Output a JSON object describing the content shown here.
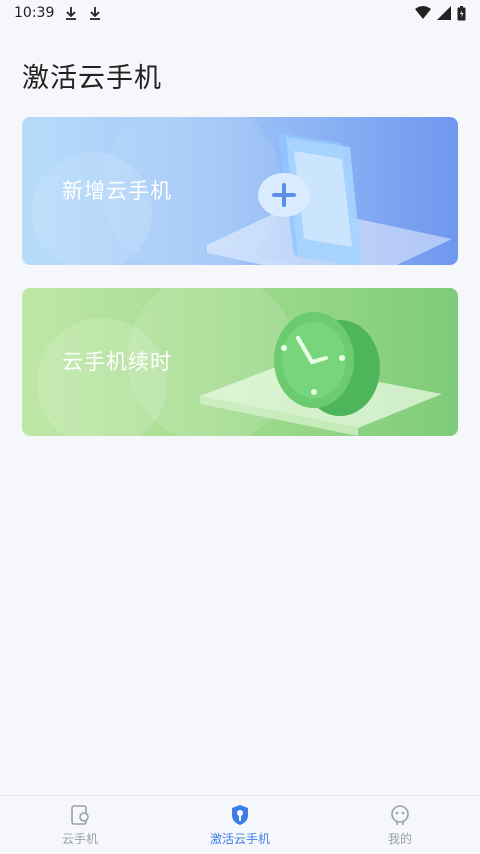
{
  "status_bar": {
    "time": "10:39"
  },
  "page": {
    "title": "激活云手机"
  },
  "cards": {
    "add": {
      "label": "新增云手机"
    },
    "renew": {
      "label": "云手机续时"
    }
  },
  "bottom_nav": {
    "items": [
      {
        "label": "云手机",
        "icon": "cloud-phone-icon",
        "active": false
      },
      {
        "label": "激活云手机",
        "icon": "shield-key-icon",
        "active": true
      },
      {
        "label": "我的",
        "icon": "profile-icon",
        "active": false
      }
    ]
  },
  "colors": {
    "accent": "#3d7ee8",
    "inactive": "#9aa0a8",
    "background": "#f6f7fb"
  }
}
